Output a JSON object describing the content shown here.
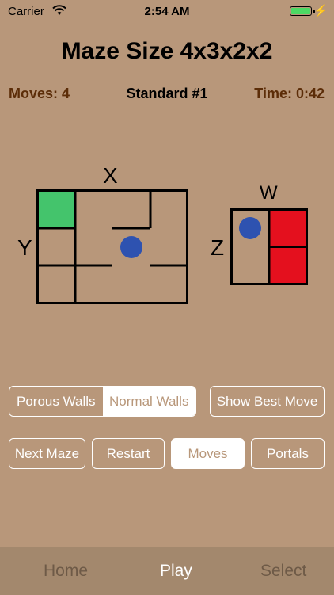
{
  "status": {
    "carrier": "Carrier",
    "time": "2:54 AM"
  },
  "title": "Maze Size 4x3x2x2",
  "info": {
    "moves": "Moves: 4",
    "level": "Standard #1",
    "timer": "Time: 0:42"
  },
  "axes": {
    "x": "X",
    "y": "Y",
    "z": "Z",
    "w": "W"
  },
  "colors": {
    "goal": "#44c46c",
    "player": "#2e52b0",
    "blocked": "#e4101e",
    "background": "#b8977a"
  },
  "segmented": {
    "options": [
      "Porous Walls",
      "Normal Walls"
    ],
    "selected": "Normal Walls"
  },
  "buttons": {
    "best_move": "Show Best Move",
    "next_maze": "Next Maze",
    "restart": "Restart",
    "moves": "Moves",
    "portals": "Portals"
  },
  "tabs": {
    "home": "Home",
    "play": "Play",
    "select": "Select",
    "selected": "Play"
  }
}
